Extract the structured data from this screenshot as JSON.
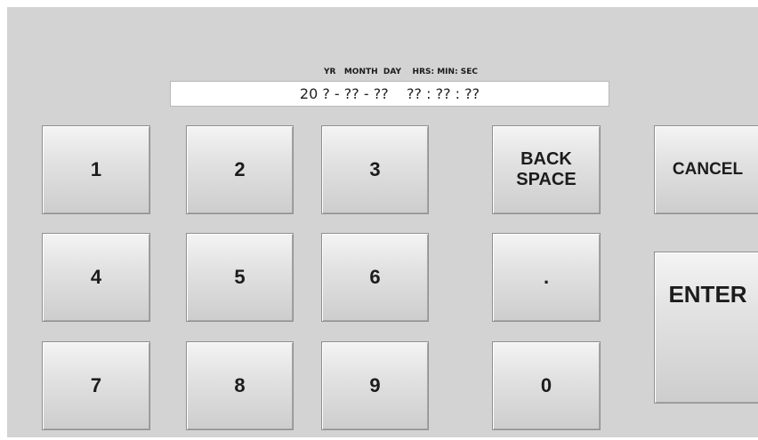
{
  "header": {
    "field_labels": "YR   MONTH  DAY    HRS: MIN: SEC"
  },
  "display": {
    "value": "20 ? - ?? - ??    ?? : ?? : ??"
  },
  "keypad": {
    "k1": "1",
    "k2": "2",
    "k3": "3",
    "backspace_line1": "BACK",
    "backspace_line2": "SPACE",
    "cancel": "CANCEL",
    "k4": "4",
    "k5": "5",
    "k6": "6",
    "dot": ".",
    "enter": "ENTER",
    "k7": "7",
    "k8": "8",
    "k9": "9",
    "k0": "0"
  }
}
